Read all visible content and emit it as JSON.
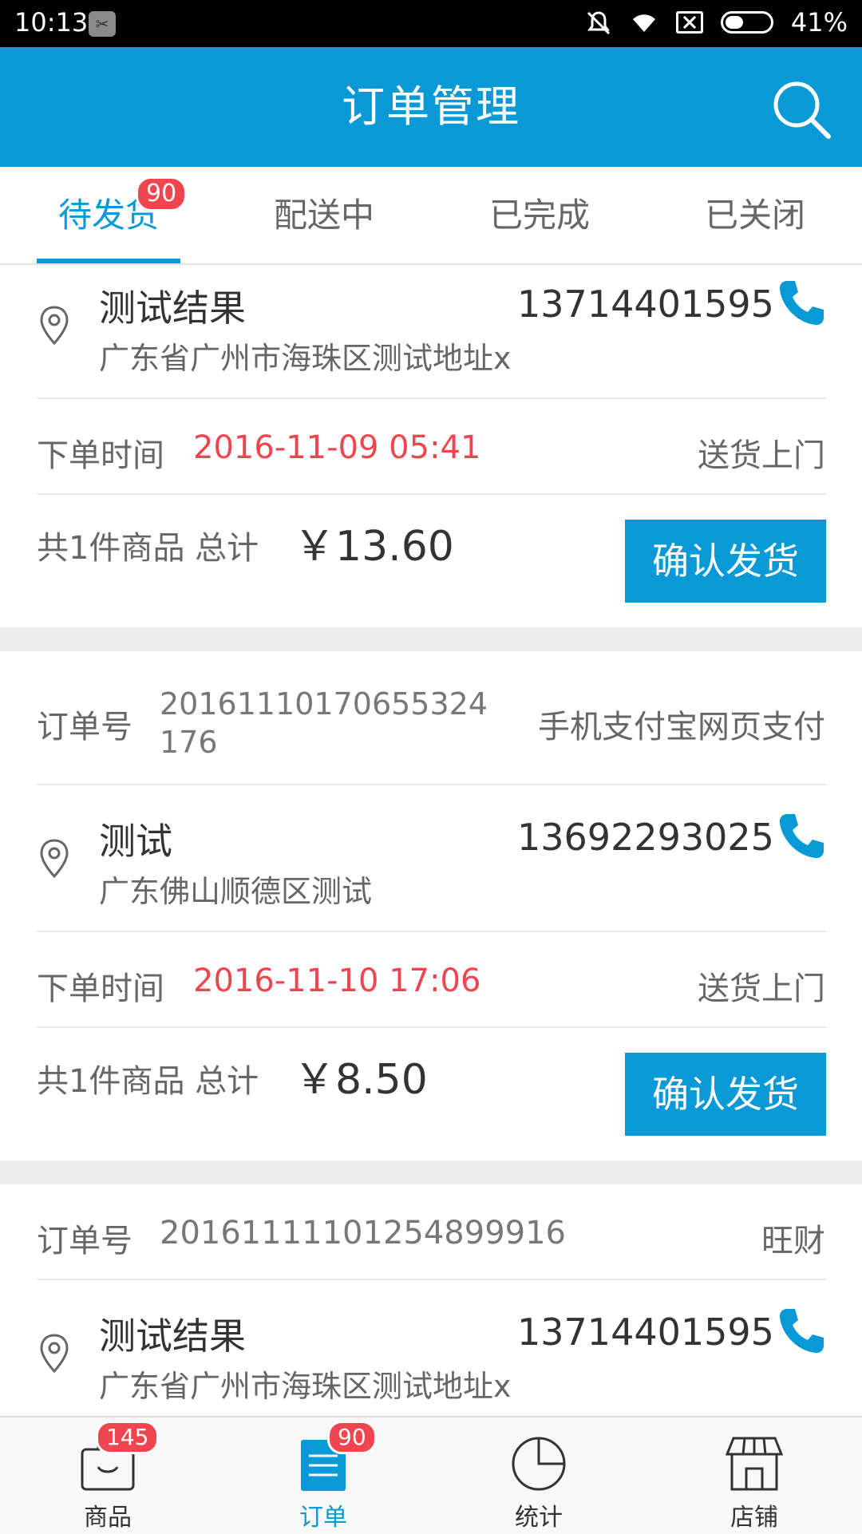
{
  "status_bar": {
    "time": "10:13",
    "battery": "41%",
    "battery_level": 0.41
  },
  "header": {
    "title": "订单管理"
  },
  "tabs": [
    {
      "label": "待发货",
      "badge": "90",
      "active": true
    },
    {
      "label": "配送中"
    },
    {
      "label": "已完成"
    },
    {
      "label": "已关闭"
    }
  ],
  "orders": [
    {
      "name": "测试结果",
      "phone": "13714401595",
      "address": "广东省广州市海珠区测试地址x",
      "time_label": "下单时间",
      "time": "2016-11-09 05:41",
      "delivery": "送货上门",
      "summary": "共1件商品 总计",
      "total": "￥13.60",
      "button": "确认发货"
    },
    {
      "order_label": "订单号",
      "order_no_line1": "20161110170655324",
      "order_no_line2": "176",
      "payment": "手机支付宝网页支付",
      "name": "测试",
      "phone": "13692293025",
      "address": "广东佛山顺德区测试",
      "time_label": "下单时间",
      "time": "2016-11-10 17:06",
      "delivery": "送货上门",
      "summary": "共1件商品 总计",
      "total": "￥8.50",
      "button": "确认发货"
    },
    {
      "order_label": "订单号",
      "order_no": "20161111101254899916",
      "payment": "旺财",
      "name": "测试结果",
      "phone": "13714401595",
      "address": "广东省广州市海珠区测试地址x"
    }
  ],
  "bottom_nav": [
    {
      "label": "商品",
      "badge": "145",
      "icon": "bag-icon"
    },
    {
      "label": "订单",
      "badge": "90",
      "icon": "order-list-icon",
      "active": true
    },
    {
      "label": "统计",
      "icon": "pie-chart-icon"
    },
    {
      "label": "店铺",
      "icon": "store-icon"
    }
  ],
  "colors": {
    "accent": "#0899d6",
    "badge": "#f0454f",
    "time_red": "#f0454f"
  }
}
